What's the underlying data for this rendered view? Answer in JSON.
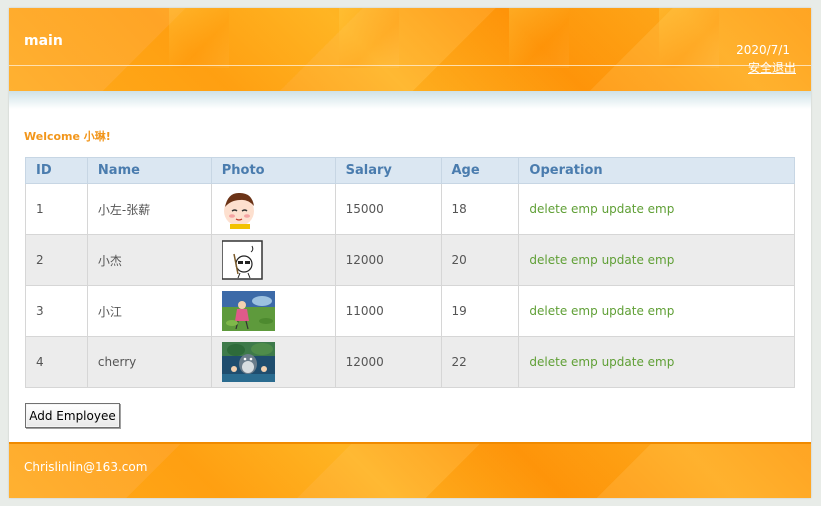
{
  "header": {
    "title": "main",
    "date": "2020/7/1",
    "logout_label": "安全退出"
  },
  "welcome": "Welcome 小琳!",
  "table": {
    "columns": [
      "ID",
      "Name",
      "Photo",
      "Salary",
      "Age",
      "Operation"
    ],
    "rows": [
      {
        "id": "1",
        "name": "小左-张薪",
        "photo": "cartoon-boy-avatar",
        "salary": "15000",
        "age": "18",
        "delete_label": "delete emp",
        "update_label": "update emp"
      },
      {
        "id": "2",
        "name": "小杰",
        "photo": "sketch-character-avatar",
        "salary": "12000",
        "age": "20",
        "delete_label": "delete emp",
        "update_label": "update emp"
      },
      {
        "id": "3",
        "name": "小江",
        "photo": "anime-girl-meadow-avatar",
        "salary": "11000",
        "age": "19",
        "delete_label": "delete emp",
        "update_label": "update emp"
      },
      {
        "id": "4",
        "name": "cherry",
        "photo": "totoro-scene-avatar",
        "salary": "12000",
        "age": "22",
        "delete_label": "delete emp",
        "update_label": "update emp"
      }
    ]
  },
  "add_button_label": "Add Employee",
  "footer": {
    "email": "Chrislinlin@163.com"
  },
  "colors": {
    "accent_orange": "#ff9d10",
    "welcome_text": "#f2961b",
    "header_text_blue": "#4a7cae",
    "link_green": "#5f9f35"
  }
}
